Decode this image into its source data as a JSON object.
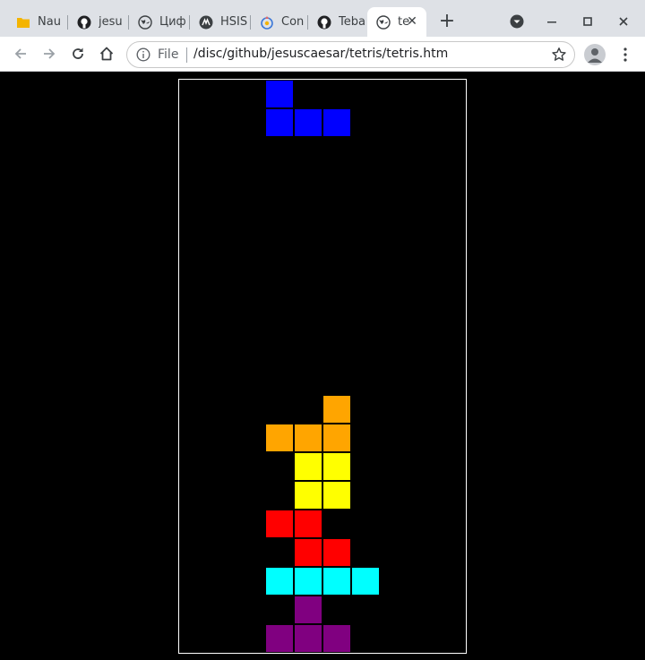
{
  "browser": {
    "tabs": [
      {
        "title": "Nau",
        "icon": "folder-icon",
        "active": false
      },
      {
        "title": "jesu",
        "icon": "github-icon",
        "active": false
      },
      {
        "title": "Циф",
        "icon": "globe-icon",
        "active": false
      },
      {
        "title": "HSIS",
        "icon": "hsis-icon",
        "active": false
      },
      {
        "title": "Con",
        "icon": "compiler-explorer-icon",
        "active": false
      },
      {
        "title": "Teba",
        "icon": "github-icon",
        "active": false
      },
      {
        "title": "te",
        "icon": "globe-icon",
        "active": true
      }
    ],
    "new_tab_label": "+",
    "address": {
      "scheme": "File",
      "url": "/disc/github/jesuscaesar/tetris/tetris.htm"
    }
  },
  "game": {
    "board": {
      "cols": 10,
      "rows": 20,
      "border_color": "#ffffff",
      "background": "#000000"
    },
    "colors": {
      "blue": "#0000ff",
      "orange": "#ffa500",
      "yellow": "#ffff00",
      "red": "#ff0000",
      "cyan": "#00ffff",
      "purple": "#800080"
    },
    "falling_piece": {
      "type": "J",
      "color": "blue",
      "cells": [
        [
          3,
          0
        ],
        [
          3,
          1
        ],
        [
          4,
          1
        ],
        [
          5,
          1
        ]
      ]
    },
    "stack": [
      {
        "col": 5,
        "row": 11,
        "color": "orange"
      },
      {
        "col": 3,
        "row": 12,
        "color": "orange"
      },
      {
        "col": 4,
        "row": 12,
        "color": "orange"
      },
      {
        "col": 5,
        "row": 12,
        "color": "orange"
      },
      {
        "col": 4,
        "row": 13,
        "color": "yellow"
      },
      {
        "col": 5,
        "row": 13,
        "color": "yellow"
      },
      {
        "col": 4,
        "row": 14,
        "color": "yellow"
      },
      {
        "col": 5,
        "row": 14,
        "color": "yellow"
      },
      {
        "col": 3,
        "row": 15,
        "color": "red"
      },
      {
        "col": 4,
        "row": 15,
        "color": "red"
      },
      {
        "col": 4,
        "row": 16,
        "color": "red"
      },
      {
        "col": 5,
        "row": 16,
        "color": "red"
      },
      {
        "col": 3,
        "row": 17,
        "color": "cyan"
      },
      {
        "col": 4,
        "row": 17,
        "color": "cyan"
      },
      {
        "col": 5,
        "row": 17,
        "color": "cyan"
      },
      {
        "col": 6,
        "row": 17,
        "color": "cyan"
      },
      {
        "col": 4,
        "row": 18,
        "color": "purple"
      },
      {
        "col": 3,
        "row": 19,
        "color": "purple"
      },
      {
        "col": 4,
        "row": 19,
        "color": "purple"
      },
      {
        "col": 5,
        "row": 19,
        "color": "purple"
      }
    ]
  }
}
